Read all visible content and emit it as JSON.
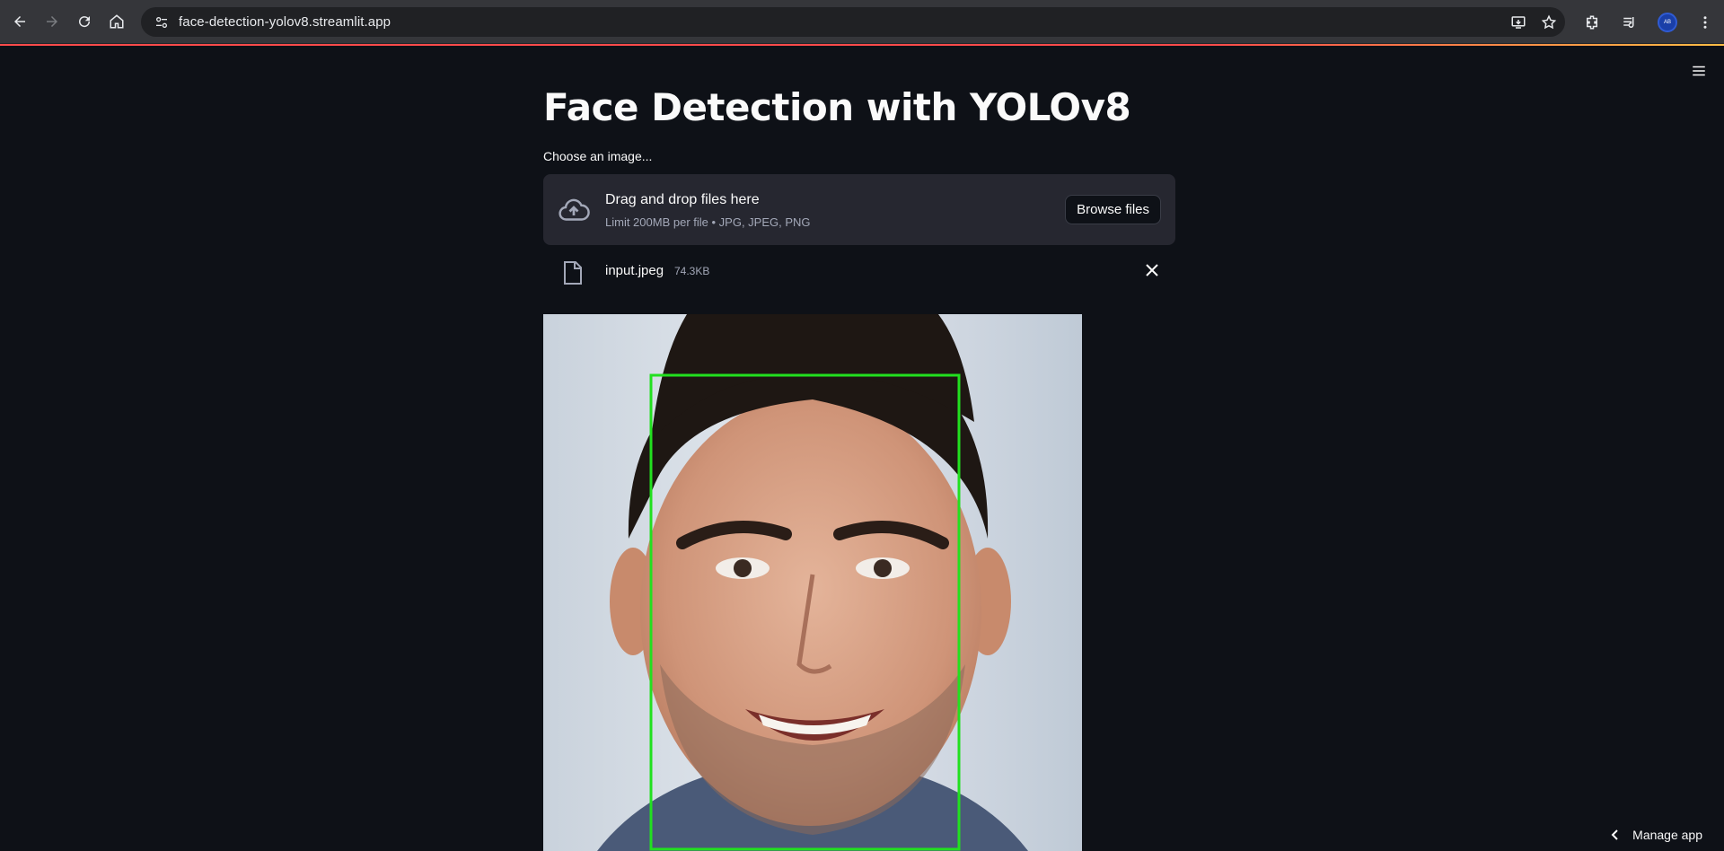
{
  "browser": {
    "url": "face-detection-yolov8.streamlit.app",
    "profile_initials": "AB"
  },
  "app": {
    "title": "Face Detection with YOLOv8",
    "uploader": {
      "label": "Choose an image...",
      "drop_title": "Drag and drop files here",
      "drop_subtitle": "Limit 200MB per file • JPG, JPEG, PNG",
      "browse_label": "Browse files"
    },
    "file": {
      "name": "input.jpeg",
      "size": "74.3KB"
    },
    "detection_box_color": "#22e01f",
    "manage_app_label": "Manage app"
  },
  "colors": {
    "background": "#0e1117",
    "dropzone": "#262730",
    "accent": "#ff4b4b"
  }
}
